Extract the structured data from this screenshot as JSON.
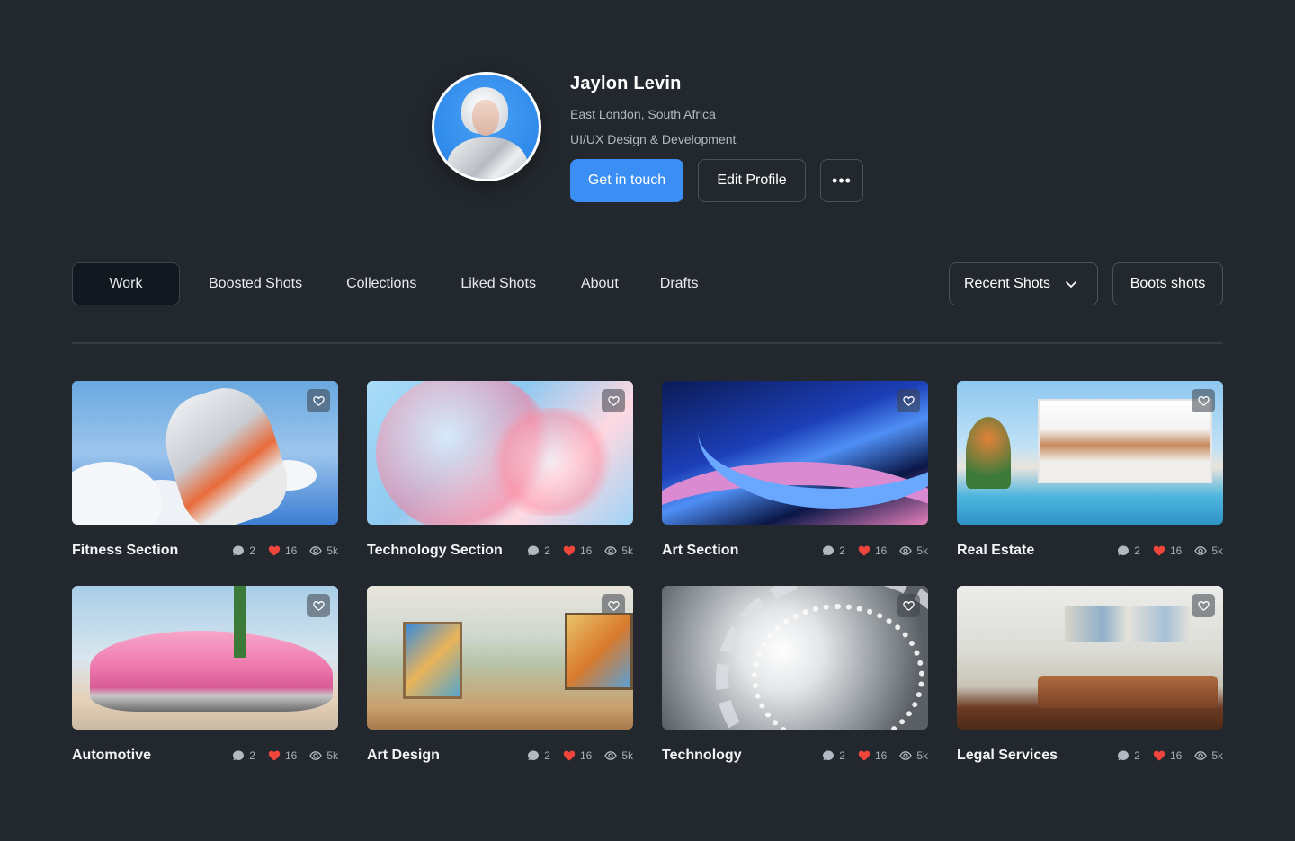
{
  "profile": {
    "name": "Jaylon Levin",
    "location": "East London, South Africa",
    "role": "UI/UX Design & Development",
    "get_in_touch_label": "Get in touch",
    "edit_profile_label": "Edit Profile",
    "more_label": "•••"
  },
  "tabs": [
    {
      "label": "Work",
      "active": true
    },
    {
      "label": "Boosted Shots",
      "active": false
    },
    {
      "label": "Collections",
      "active": false
    },
    {
      "label": "Liked Shots",
      "active": false
    },
    {
      "label": "About",
      "active": false
    },
    {
      "label": "Drafts",
      "active": false
    }
  ],
  "filters": {
    "sort_selected": "Recent Shots",
    "boots_label": "Boots shots"
  },
  "shots": [
    {
      "title": "Fitness Section",
      "comments": "2",
      "likes": "16",
      "views": "5k"
    },
    {
      "title": "Technology Section",
      "comments": "2",
      "likes": "16",
      "views": "5k"
    },
    {
      "title": "Art Section",
      "comments": "2",
      "likes": "16",
      "views": "5k"
    },
    {
      "title": "Real Estate",
      "comments": "2",
      "likes": "16",
      "views": "5k"
    },
    {
      "title": "Automotive",
      "comments": "2",
      "likes": "16",
      "views": "5k"
    },
    {
      "title": "Art Design",
      "comments": "2",
      "likes": "16",
      "views": "5k"
    },
    {
      "title": "Technology",
      "comments": "2",
      "likes": "16",
      "views": "5k"
    },
    {
      "title": "Legal Services",
      "comments": "2",
      "likes": "16",
      "views": "5k"
    }
  ],
  "icons": {
    "favorite": "heart-outline-icon",
    "comment": "comment-bubble-icon",
    "like": "heart-filled-icon",
    "views": "eye-icon",
    "dropdown": "chevron-down-icon"
  },
  "colors": {
    "background": "#23282e",
    "accent": "#3b8ef3",
    "like": "#f0453a"
  }
}
